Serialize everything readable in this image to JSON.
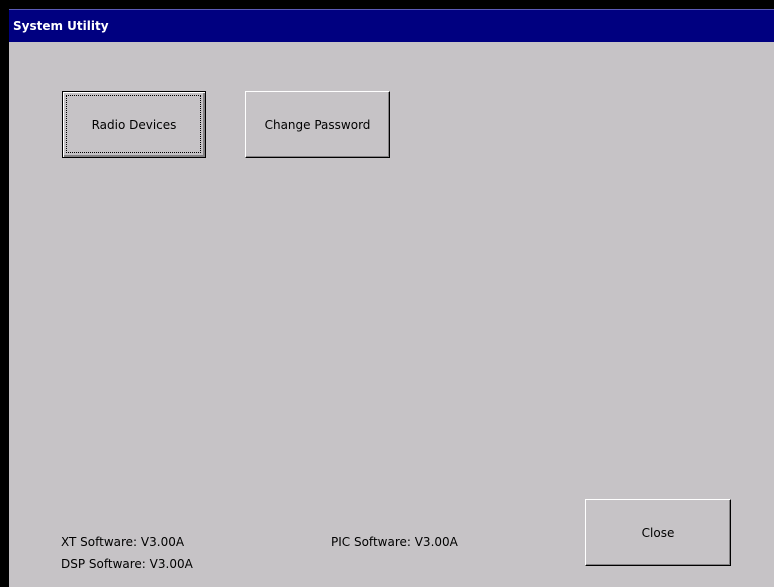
{
  "window": {
    "title": "System Utility"
  },
  "buttons": {
    "radio_devices": "Radio Devices",
    "change_password": "Change Password",
    "close": "Close"
  },
  "versions": {
    "xt": "XT Software: V3.00A",
    "pic": "PIC Software: V3.00A",
    "dsp": "DSP Software: V3.00A"
  },
  "colors": {
    "titlebar": "#000080",
    "window_bg": "#c6c3c6",
    "title_text": "#ffffff"
  }
}
